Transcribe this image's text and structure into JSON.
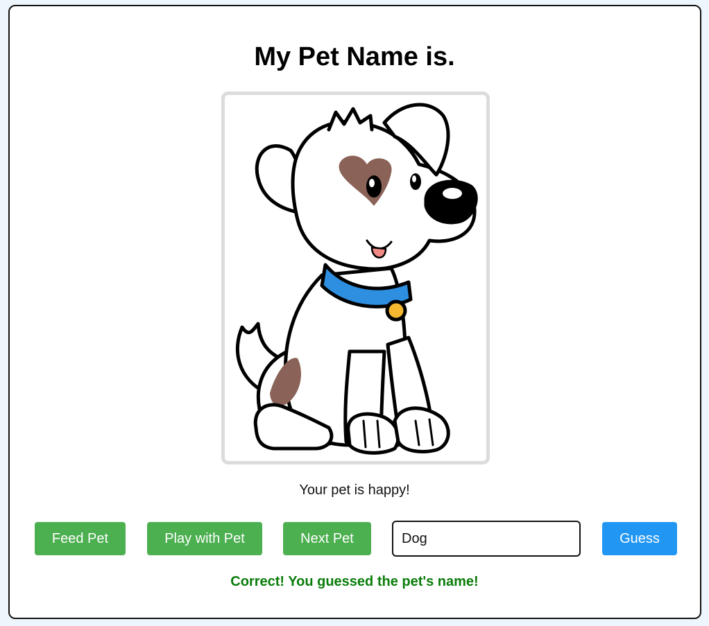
{
  "page": {
    "title": "My Pet Name is."
  },
  "pet": {
    "image_icon": "cartoon-puppy",
    "status": "Your pet is happy!"
  },
  "controls": {
    "feed_label": "Feed Pet",
    "play_label": "Play with Pet",
    "next_label": "Next Pet",
    "guess_input_value": "Dog",
    "guess_label": "Guess"
  },
  "result": {
    "message": "Correct! You guessed the pet's name!"
  },
  "colors": {
    "action_button": "#4caf50",
    "guess_button": "#2196f3",
    "success_text": "#0a7d0a",
    "collar": "#2e8fe0",
    "spot": "#8a6258",
    "tag": "#f5b82e"
  }
}
